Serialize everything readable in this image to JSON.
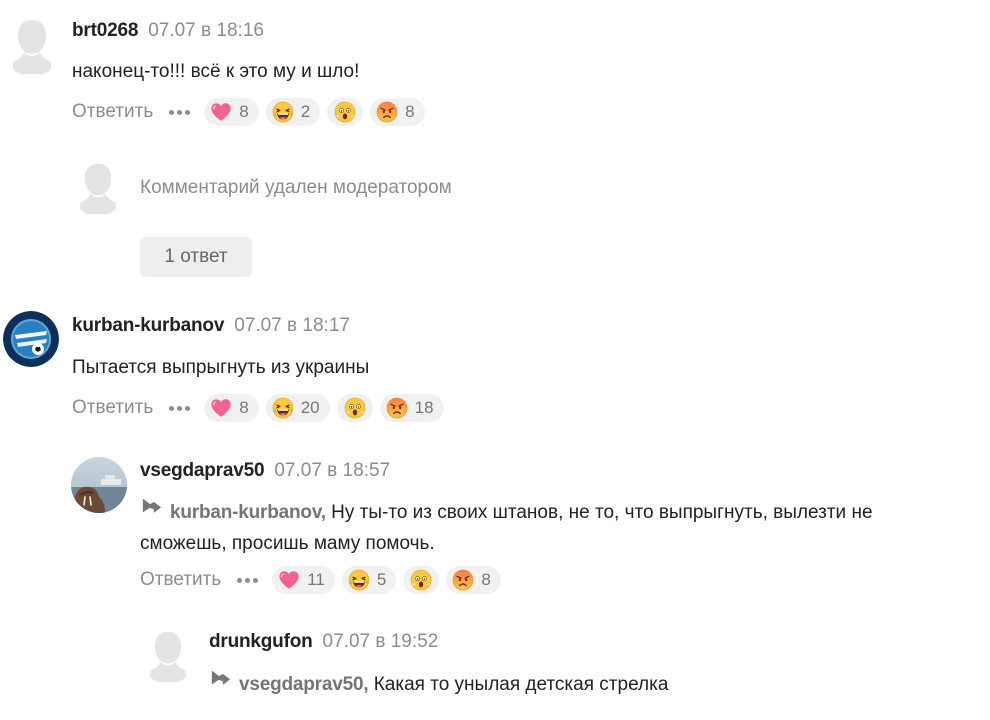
{
  "colors": {
    "heart": "#f06292",
    "emoji_yellow": "#ffc83d",
    "angry": "#ff8a4c",
    "meta_grey": "#8c8c8c"
  },
  "comments": [
    {
      "username": "brt0268",
      "time": "07.07 в 18:16",
      "text": "наконец-то!!! всё к это му и шло!",
      "reply_label": "Ответить",
      "reactions": [
        {
          "icon": "heart-icon",
          "count": "8"
        },
        {
          "icon": "laughing-face-icon",
          "count": "2"
        },
        {
          "icon": "shocked-face-icon",
          "count": ""
        },
        {
          "icon": "angry-face-icon",
          "count": "8"
        }
      ]
    },
    {
      "deleted_text": "Комментарий удален модератором",
      "replies_button": "1 ответ"
    },
    {
      "username": "kurban-kurbanov",
      "time": "07.07 в 18:17",
      "text": "Пытается выпрыгнуть из украины",
      "reply_label": "Ответить",
      "reactions": [
        {
          "icon": "heart-icon",
          "count": "8"
        },
        {
          "icon": "laughing-face-icon",
          "count": "20"
        },
        {
          "icon": "shocked-face-icon",
          "count": ""
        },
        {
          "icon": "angry-face-icon",
          "count": "18"
        }
      ]
    },
    {
      "username": "vsegdaprav50",
      "time": "07.07 в 18:57",
      "reply_to": "kurban-kurbanov,",
      "text_line1": "Ну ты-то из своих штанов, не то, что выпрыгнуть, вылезти не",
      "text_line2": "сможешь, просишь маму помочь.",
      "reply_label": "Ответить",
      "reactions": [
        {
          "icon": "heart-icon",
          "count": "11"
        },
        {
          "icon": "laughing-face-icon",
          "count": "5"
        },
        {
          "icon": "shocked-face-icon",
          "count": ""
        },
        {
          "icon": "angry-face-icon",
          "count": "8"
        }
      ]
    },
    {
      "username": "drunkgufon",
      "time": "07.07 в 19:52",
      "reply_to": "vsegdaprav50,",
      "text": "Какая то унылая детская стрелка"
    }
  ]
}
